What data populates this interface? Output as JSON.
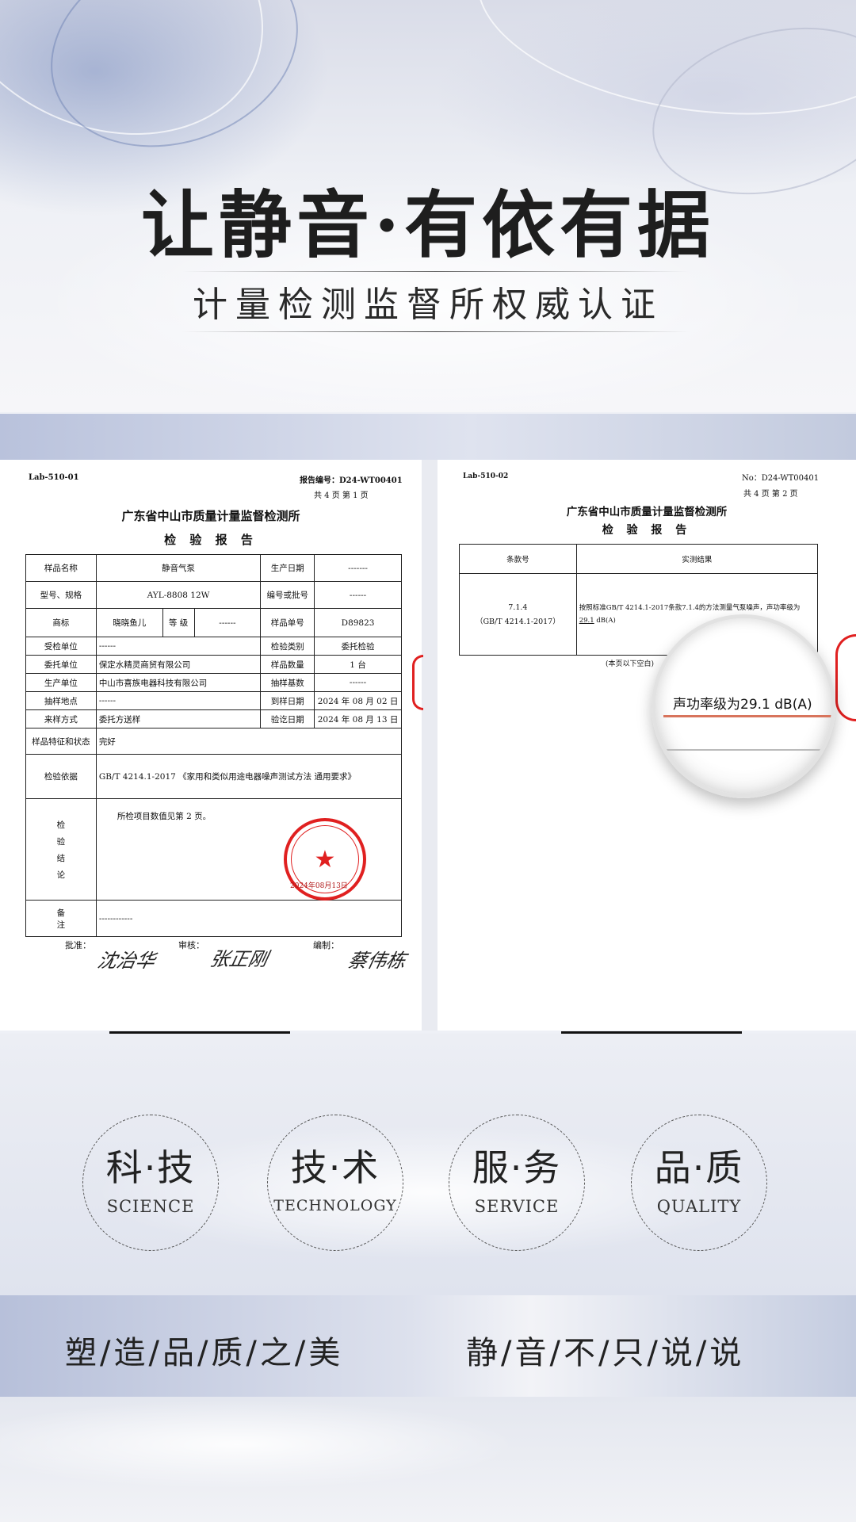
{
  "hero": {
    "title": "让静音·有依有据",
    "subtitle": "计量检测监督所权威认证"
  },
  "doc1": {
    "lab_code": "Lab-510-01",
    "report_no": "报告编号：D24-WT00401",
    "pages": "共 4 页  第 1 页",
    "institute": "广东省中山市质量计量监督检测所",
    "report_title": "检 验 报 告",
    "rows": {
      "sample_name_label": "样品名称",
      "sample_name": "静音气泵",
      "prod_date_label": "生产日期",
      "prod_date": "-------",
      "model_label": "型号、规格",
      "model": "AYL-8808   12W",
      "batch_label": "编号或批号",
      "batch": "------",
      "brand_label": "商标",
      "brand": "晓晓鱼儿",
      "grade_label": "等 级",
      "grade": "------",
      "sample_no_label": "样品单号",
      "sample_no": "D89823",
      "inspected_label": "受检单位",
      "inspected": "------",
      "type_label": "检验类别",
      "type": "委托检验",
      "client_label": "委托单位",
      "client": "保定水精灵商贸有限公司",
      "qty_label": "样品数量",
      "qty": "1 台",
      "producer_label": "生产单位",
      "producer": "中山市喜族电器科技有限公司",
      "base_label": "抽样基数",
      "base": "------",
      "site_label": "抽样地点",
      "site": "------",
      "arrive_label": "到样日期",
      "arrive": "2024 年 08 月 02 日",
      "method_label": "来样方式",
      "method": "委托方送样",
      "done_label": "验讫日期",
      "done": "2024 年 08 月 13 日",
      "state_label": "样品特征和状态",
      "state": "完好",
      "basis_label": "检验依据",
      "basis": "GB/T 4214.1-2017 《家用和类似用途电器噪声测试方法 通用要求》",
      "conclusion_label_1": "检",
      "conclusion_label_2": "验",
      "conclusion_label_3": "结",
      "conclusion_label_4": "论",
      "conclusion": "所检项目数值见第 2 页。",
      "seal_text": "2024年08月13日",
      "note_label_1": "备",
      "note_label_2": "注",
      "note": "------------"
    },
    "approve_label": "批准：",
    "review_label": "审核：",
    "compile_label": "编制：",
    "sig_approve": "沈治华",
    "sig_review": "张正刚",
    "sig_compile": "蔡伟栋"
  },
  "doc2": {
    "lab_code": "Lab-510-02",
    "report_no": "No：D24-WT00401",
    "pages": "共 4 页   第 2 页",
    "institute": "广东省中山市质量计量监督检测所",
    "report_title": "检 验 报 告",
    "col1": "条款号",
    "col2": "实测结果",
    "clause_1": "7.1.4",
    "clause_2": "（GB/T 4214.1-2017）",
    "result": "按照标准GB/T 4214.1-2017条款7.1.4的方法测量气泵噪声，声功率级为",
    "result_value": "29.1",
    "result_unit": "dB(A)",
    "blank_note": "(本页以下空白)"
  },
  "magnifier": {
    "text": "声功率级为29.1 dB(A)"
  },
  "badges": [
    {
      "cn": "科·技",
      "en": "SCIENCE"
    },
    {
      "cn": "技·术",
      "en": "TECHNOLOGY"
    },
    {
      "cn": "服·务",
      "en": "SERVICE"
    },
    {
      "cn": "品·质",
      "en": "QUALITY"
    }
  ],
  "slogans": {
    "left": "塑/造/品/质/之/美",
    "right": "静/音/不/只/说/说"
  }
}
